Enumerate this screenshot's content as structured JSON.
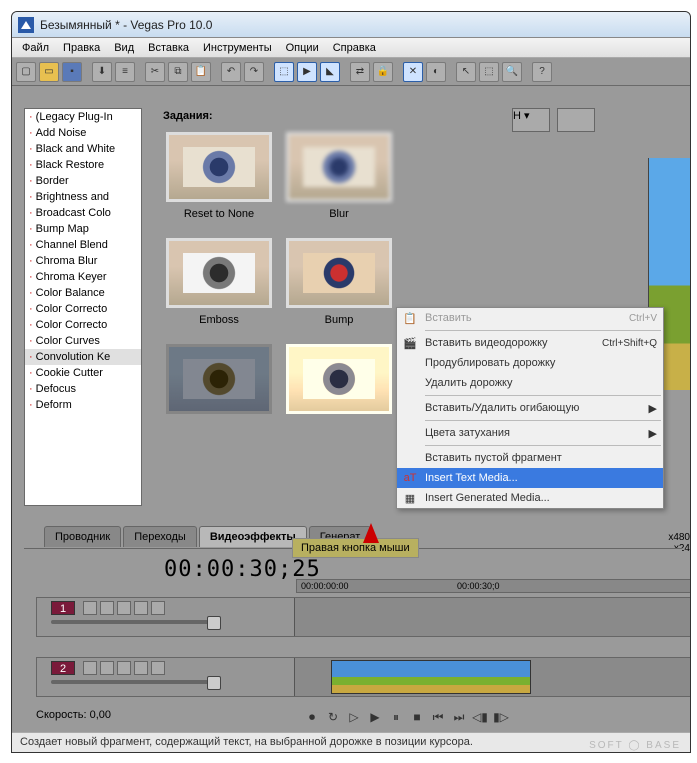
{
  "title": "Безымянный * - Vegas Pro 10.0",
  "menu": [
    "Файл",
    "Правка",
    "Вид",
    "Вставка",
    "Инструменты",
    "Опции",
    "Справка"
  ],
  "presets_header": "Задания:",
  "plugins": [
    "(Legacy Plug-In",
    "Add Noise",
    "Black and White",
    "Black Restore",
    "Border",
    "Brightness and",
    "Broadcast Colo",
    "Bump Map",
    "Channel Blend",
    "Chroma Blur",
    "Chroma Keyer",
    "Color Balance",
    "Color Correcto",
    "Color Correcto",
    "Color Curves",
    "Convolution Ke",
    "Cookie Cutter",
    "Defocus",
    "Deform"
  ],
  "plugin_selected": 15,
  "presets": [
    "Reset to None",
    "Blur",
    "Emboss",
    "Bump",
    "",
    ""
  ],
  "tabs": [
    "Проводник",
    "Переходы",
    "Видеоэффекты",
    "Генерат"
  ],
  "active_tab": 2,
  "timecode": "00:00:30;25",
  "ruler": [
    "00:00:00:00",
    "00:00:30;0"
  ],
  "tracks": [
    {
      "num": "1"
    },
    {
      "num": "2"
    }
  ],
  "speed_label": "Скорость: 0,00",
  "tooltip": "Правая кнопка мыши",
  "resolution": "x480\nx24",
  "ctx": {
    "paste": "Вставить",
    "paste_sc": "Ctrl+V",
    "insert_video": "Вставить видеодорожку",
    "insert_video_sc": "Ctrl+Shift+Q",
    "duplicate": "Продублировать дорожку",
    "delete": "Удалить дорожку",
    "envelope": "Вставить/Удалить огибающую",
    "fade": "Цвета затухания",
    "empty": "Вставить пустой фрагмент",
    "text": "Insert Text Media...",
    "generated": "Insert Generated Media..."
  },
  "status": "Создает новый фрагмент, содержащий текст, на выбранной дорожке в позиции курсора.",
  "watermark": "SOFT ◯ BASE"
}
